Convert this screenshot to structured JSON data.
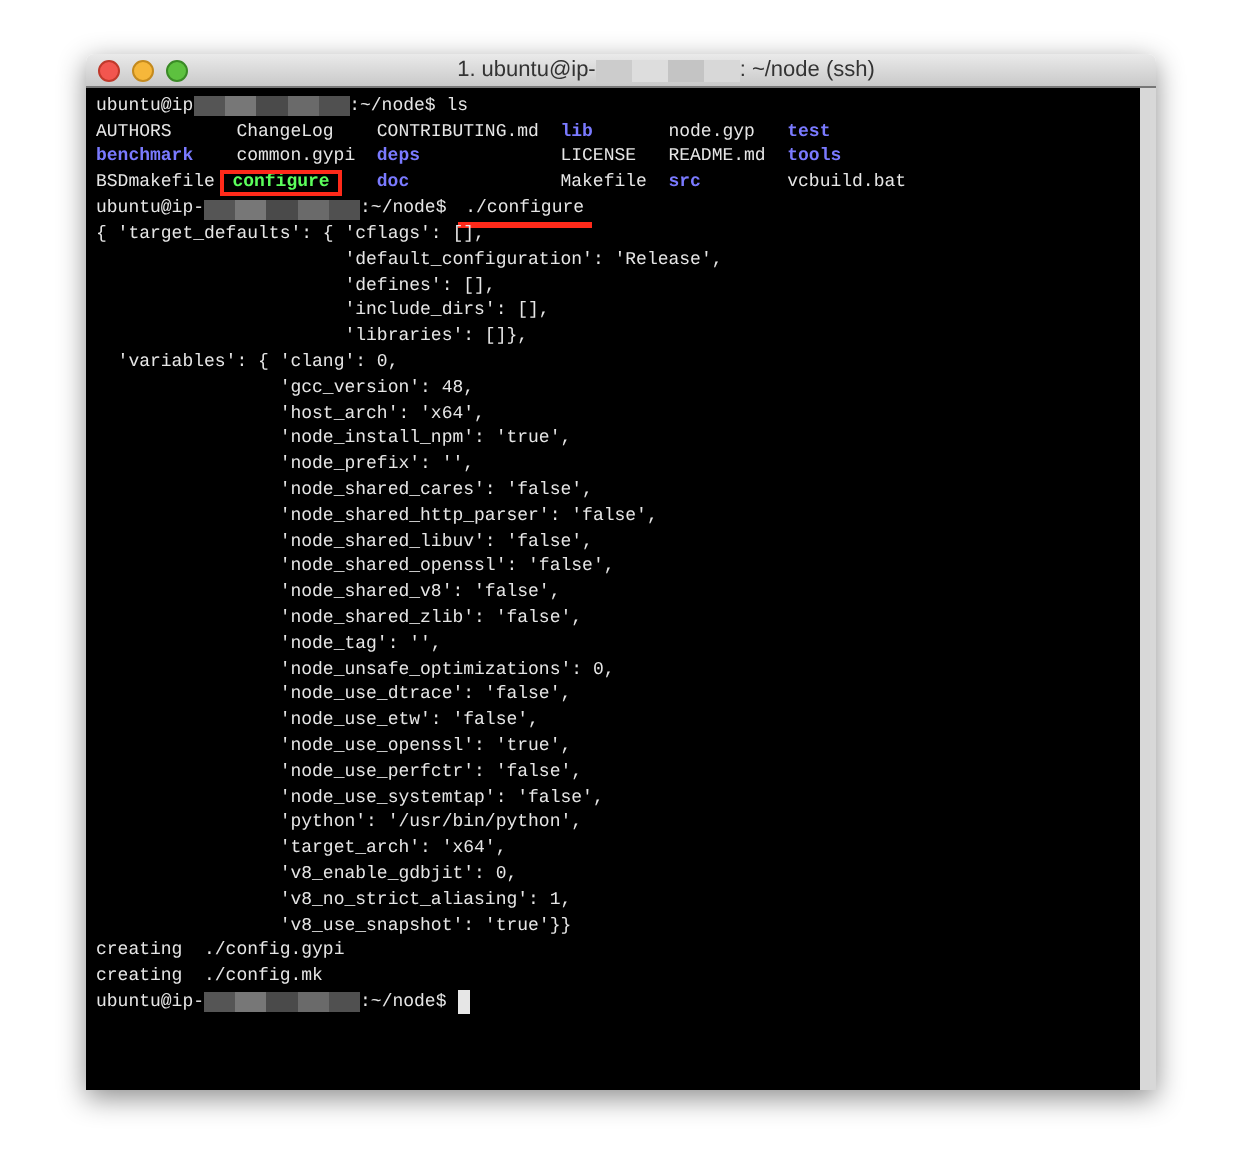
{
  "window": {
    "title_prefix": "1. ubuntu@ip-",
    "title_suffix": ": ~/node (ssh)"
  },
  "terminal": {
    "blocks": [
      {
        "kind": "prompt",
        "user": "ubuntu@ip",
        "path": ":~/node$",
        "command": "ls"
      },
      {
        "kind": "listing",
        "entries": [
          {
            "name": "AUTHORS",
            "kind": "file",
            "highlighted": false
          },
          {
            "name": "ChangeLog",
            "kind": "file",
            "highlighted": false
          },
          {
            "name": "CONTRIBUTING.md",
            "kind": "file",
            "highlighted": false
          },
          {
            "name": "lib",
            "kind": "dir",
            "highlighted": false
          },
          {
            "name": "node.gyp",
            "kind": "file",
            "highlighted": false
          },
          {
            "name": "test",
            "kind": "dir",
            "highlighted": false
          },
          {
            "name": "benchmark",
            "kind": "dir",
            "highlighted": false
          },
          {
            "name": "common.gypi",
            "kind": "file",
            "highlighted": false
          },
          {
            "name": "deps",
            "kind": "dir",
            "highlighted": false
          },
          {
            "name": "LICENSE",
            "kind": "file",
            "highlighted": false
          },
          {
            "name": "README.md",
            "kind": "file",
            "highlighted": false
          },
          {
            "name": "tools",
            "kind": "dir",
            "highlighted": false
          },
          {
            "name": "BSDmakefile",
            "kind": "file",
            "highlighted": false
          },
          {
            "name": "configure",
            "kind": "exec",
            "highlighted": true
          },
          {
            "name": "doc",
            "kind": "dir",
            "highlighted": false
          },
          {
            "name": "Makefile",
            "kind": "file",
            "highlighted": false
          },
          {
            "name": "src",
            "kind": "dir",
            "highlighted": false
          },
          {
            "name": "vcbuild.bat",
            "kind": "file",
            "highlighted": false
          }
        ]
      },
      {
        "kind": "prompt",
        "user": "ubuntu@ip-",
        "path": ":~/node$",
        "command": "./configure",
        "underlined": true
      },
      {
        "kind": "output",
        "lines": [
          "{ 'target_defaults': { 'cflags': [],",
          "                       'default_configuration': 'Release',",
          "                       'defines': [],",
          "                       'include_dirs': [],",
          "                       'libraries': []},",
          "  'variables': { 'clang': 0,",
          "                 'gcc_version': 48,",
          "                 'host_arch': 'x64',",
          "                 'node_install_npm': 'true',",
          "                 'node_prefix': '',",
          "                 'node_shared_cares': 'false',",
          "                 'node_shared_http_parser': 'false',",
          "                 'node_shared_libuv': 'false',",
          "                 'node_shared_openssl': 'false',",
          "                 'node_shared_v8': 'false',",
          "                 'node_shared_zlib': 'false',",
          "                 'node_tag': '',",
          "                 'node_unsafe_optimizations': 0,",
          "                 'node_use_dtrace': 'false',",
          "                 'node_use_etw': 'false',",
          "                 'node_use_openssl': 'true',",
          "                 'node_use_perfctr': 'false',",
          "                 'node_use_systemtap': 'false',",
          "                 'python': '/usr/bin/python',",
          "                 'target_arch': 'x64',",
          "                 'v8_enable_gdbjit': 0,",
          "                 'v8_no_strict_aliasing': 1,",
          "                 'v8_use_snapshot': 'true'}}",
          "creating  ./config.gypi",
          "creating  ./config.mk"
        ]
      },
      {
        "kind": "prompt",
        "user": "ubuntu@ip-",
        "path": ":~/node$",
        "cursor": true
      }
    ]
  }
}
